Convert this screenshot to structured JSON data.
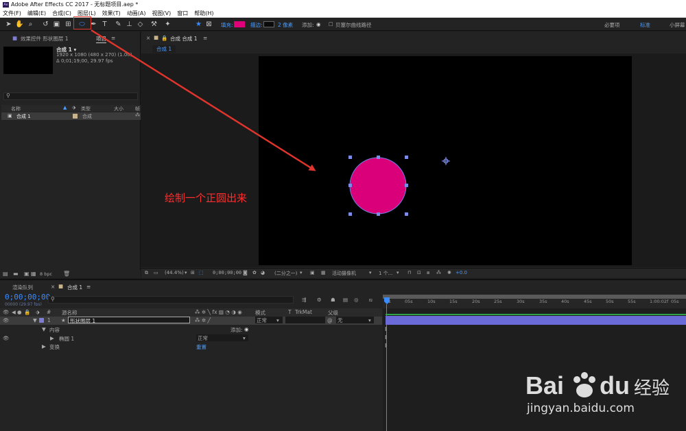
{
  "window": {
    "title": "Adobe After Effects CC 2017 - 无标题项目.aep *",
    "app_icon": "Ae"
  },
  "menu": [
    "文件(F)",
    "编辑(E)",
    "合成(C)",
    "图层(L)",
    "效果(T)",
    "动画(A)",
    "视图(V)",
    "窗口",
    "帮助(H)"
  ],
  "toolbar": {
    "fill_label": "填充:",
    "fill_color": "#e0007a",
    "stroke_label": "描边:",
    "stroke_width": "2 像素",
    "add_label": "添加:",
    "bezier_label": "贝塞尔曲线路径",
    "workspace": [
      "必要项",
      "标准",
      "小屏幕"
    ]
  },
  "left_panel": {
    "tab_effects": "效果控件 形状图层 1",
    "tab_project": "项目",
    "comp_name": "合成 1 ▾",
    "comp_res": "1920 x 1080 (480 x 270) (1.00)",
    "comp_dur": "Δ 0;01;19;00, 29.97 fps",
    "columns": [
      "名称",
      "类型",
      "大小",
      "帧"
    ],
    "item_name": "合成 1",
    "item_type": "合成",
    "bpc": "8 bpc"
  },
  "comp_panel": {
    "tab": "合成 合成 1",
    "subtab": "合成 1",
    "zoom": "(44.4%)",
    "timecode": "0;00;00;00",
    "resolution": "(二分之一)",
    "camera": "活动摄像机",
    "views": "1 个...",
    "offset": "+0.0",
    "circle_color": "#d9007a"
  },
  "timeline": {
    "tab_render": "渲染队列",
    "tab_comp": "合成 1",
    "timecode": "0;00;00;00",
    "frames": "00000 (29.97 fps)",
    "col_hash": "#",
    "col_source": "源名称",
    "col_mode": "模式",
    "col_t": "T",
    "col_trkmat": "TrkMat",
    "col_parent": "父级",
    "layer_num": "1",
    "layer_name": "形状图层 1",
    "layer_mode": "正常",
    "layer_parent": "无",
    "contents": "内容",
    "add": "添加:",
    "ellipse": "椭圆 1",
    "ellipse_mode": "正常",
    "transform": "变换",
    "reset": "重置",
    "ruler": [
      "0s",
      "05s",
      "10s",
      "15s",
      "20s",
      "25s",
      "30s",
      "35s",
      "40s",
      "45s",
      "50s",
      "55s",
      "1:00:02f",
      "05s"
    ]
  },
  "annotation": {
    "text": "绘制一个正圆出来",
    "color": "#ff2e2e"
  },
  "watermark": {
    "brand": "Bai",
    "brand2": "du",
    "cn": "经验",
    "url": "jingyan.baidu.com"
  }
}
